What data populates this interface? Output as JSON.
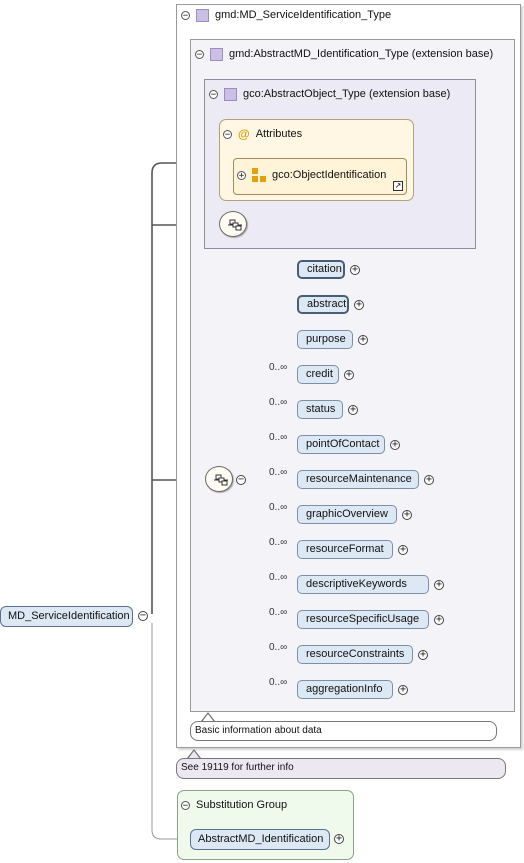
{
  "root": {
    "label": "MD_ServiceIdentification"
  },
  "type_panel": {
    "title": "gmd:MD_ServiceIdentification_Type"
  },
  "ext_panel": {
    "title": "gmd:AbstractMD_Identification_Type (extension base)"
  },
  "obj_panel": {
    "title": "gco:AbstractObject_Type (extension base)"
  },
  "attributes": {
    "title": "Attributes",
    "group": "gco:ObjectIdentification"
  },
  "elements": [
    {
      "label": "citation",
      "card": "",
      "style": "bold"
    },
    {
      "label": "abstract",
      "card": "",
      "style": "bold"
    },
    {
      "label": "purpose",
      "card": "",
      "style": "normal"
    },
    {
      "label": "credit",
      "card": "0..∞",
      "style": "normal"
    },
    {
      "label": "status",
      "card": "0..∞",
      "style": "normal"
    },
    {
      "label": "pointOfContact",
      "card": "0..∞",
      "style": "normal"
    },
    {
      "label": "resourceMaintenance",
      "card": "0..∞",
      "style": "normal"
    },
    {
      "label": "graphicOverview",
      "card": "0..∞",
      "style": "normal"
    },
    {
      "label": "resourceFormat",
      "card": "0..∞",
      "style": "normal"
    },
    {
      "label": "descriptiveKeywords",
      "card": "0..∞",
      "style": "normal"
    },
    {
      "label": "resourceSpecificUsage",
      "card": "0..∞",
      "style": "normal"
    },
    {
      "label": "resourceConstraints",
      "card": "0..∞",
      "style": "normal"
    },
    {
      "label": "aggregationInfo",
      "card": "0..∞",
      "style": "normal"
    }
  ],
  "annotations": {
    "basic": "Basic information about data",
    "see": "See 19119 for further info"
  },
  "substitution": {
    "title": "Substitution Group",
    "member": "AbstractMD_Identification"
  },
  "icons": {
    "collapse": "minus-circle-icon",
    "expand": "plus-circle-icon",
    "type": "complex-type-icon",
    "attributes": "at-sign-icon",
    "attribute_group": "attribute-group-icon",
    "sequence": "sequence-compositor-icon"
  }
}
